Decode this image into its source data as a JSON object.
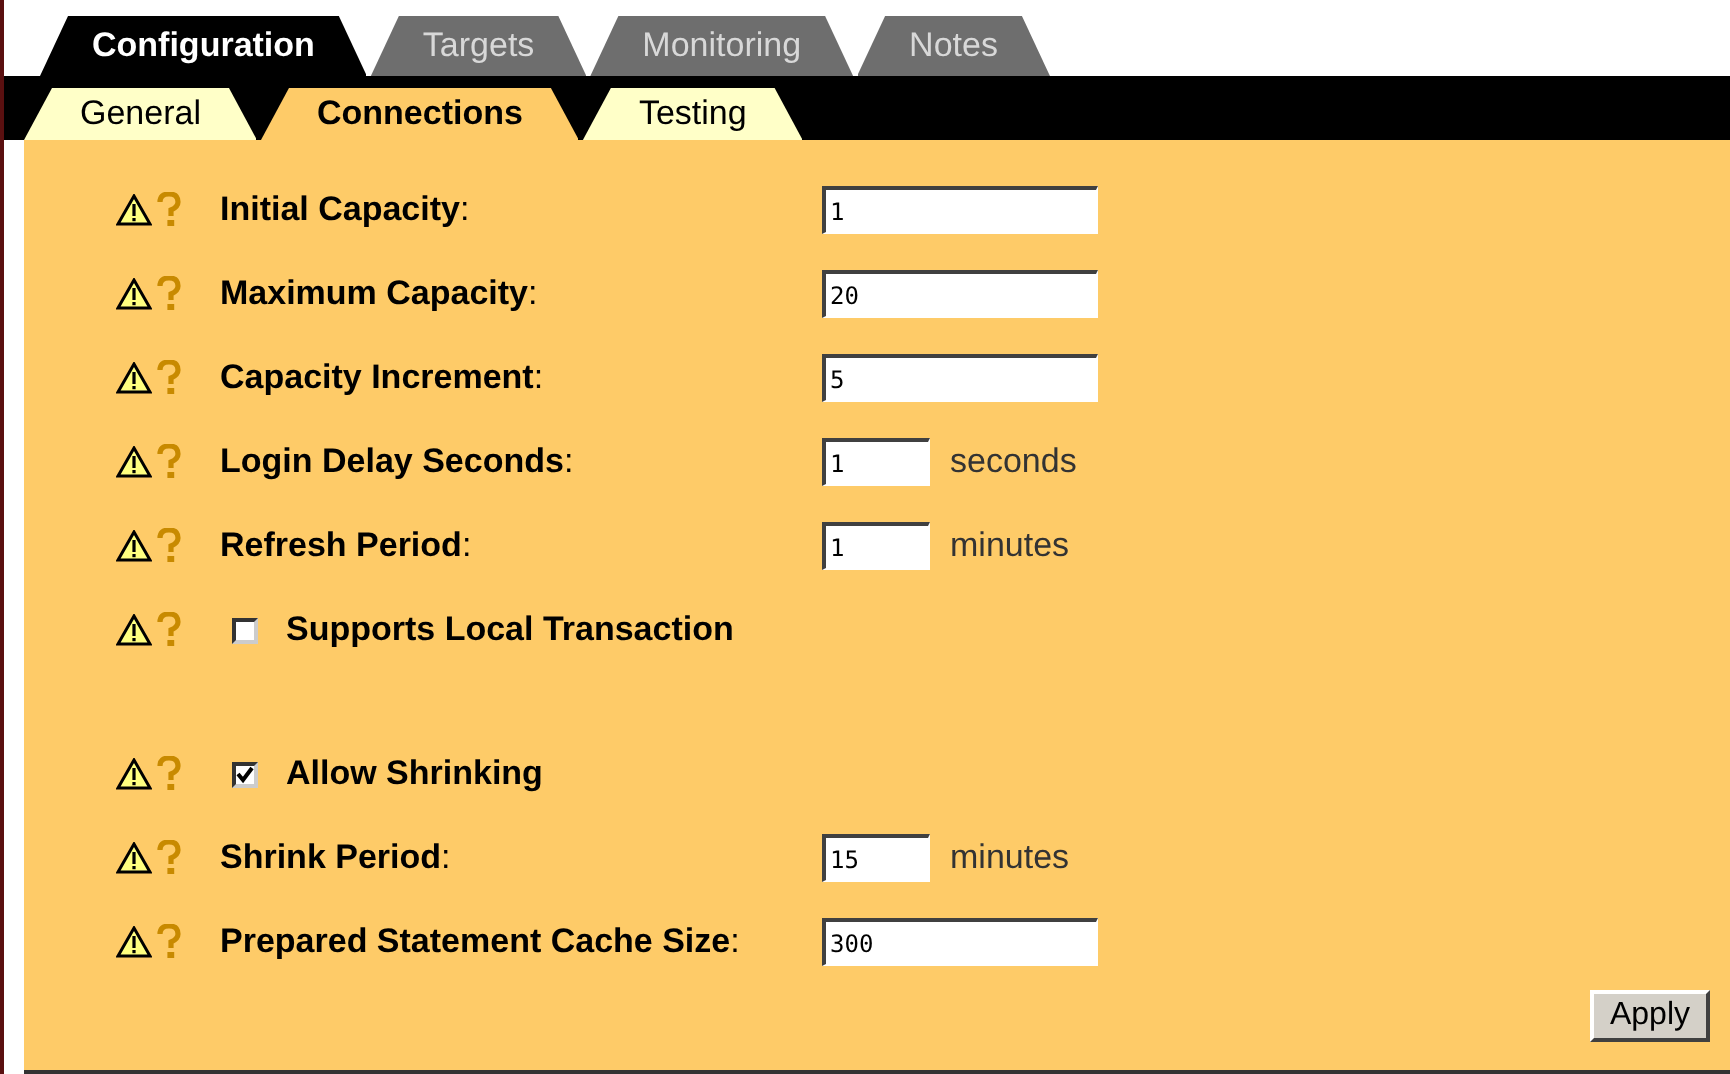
{
  "tabs": [
    {
      "label": "Configuration",
      "selected": true
    },
    {
      "label": "Targets",
      "selected": false
    },
    {
      "label": "Monitoring",
      "selected": false
    },
    {
      "label": "Notes",
      "selected": false
    }
  ],
  "subtabs": [
    {
      "label": "General",
      "selected": false
    },
    {
      "label": "Connections",
      "selected": true
    },
    {
      "label": "Testing",
      "selected": false
    }
  ],
  "sections": [
    [
      {
        "kind": "field",
        "label": "**Initial Capacity**:",
        "value": "1"
      },
      {
        "kind": "field",
        "label": "**Maximum Capacity**:",
        "value": "20"
      },
      {
        "kind": "field",
        "label": "**Capacity Increment**:",
        "value": "5"
      },
      {
        "kind": "field",
        "label": "**Login Delay Seconds**:",
        "value": "1",
        "unit": "seconds"
      },
      {
        "kind": "field",
        "label": "**Refresh Period**:",
        "value": "1",
        "unit": "minutes"
      },
      {
        "kind": "checkbox",
        "label": "Supports Local Transaction",
        "checked": false
      }
    ],
    [
      {
        "kind": "checkbox",
        "label": "Allow Shrinking",
        "checked": true
      },
      {
        "kind": "field",
        "label": "**Shrink Period**:",
        "value": "15",
        "unit": "minutes"
      },
      {
        "kind": "field",
        "label": "**Prepared Statement Cache Size**:",
        "value": "300"
      }
    ]
  ],
  "apply_button": "Apply"
}
